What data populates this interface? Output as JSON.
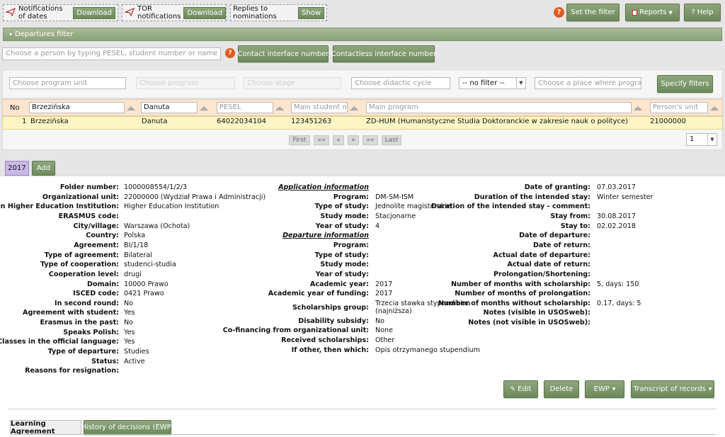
{
  "toolbar": {
    "notif_dates": {
      "label": "Notifications of dates",
      "button": "Download"
    },
    "notif_tor": {
      "label": "TOR notifications",
      "button": "Download"
    },
    "replies": {
      "label": "Replies to nominations",
      "button": "Show"
    },
    "help_mark": "?",
    "set_filter": "Set the filter",
    "reports": "Reports",
    "help": "Help"
  },
  "departures_filter": {
    "label": "Departures filter"
  },
  "person_search": {
    "placeholder": "Choose a person by typing PESEL, student number or name",
    "help_mark": "?",
    "contact_btn": "Contact interface number",
    "contactless_btn": "Contactless interface number"
  },
  "filters": {
    "program_unit": "Choose program unit",
    "program": "Choose program",
    "stage": "Choose stage",
    "didactic_cycle": "Choose didactic cycle",
    "no_filter": "-- no filter --",
    "place": "Choose a place where program is ta",
    "specify_btn": "Specify filters"
  },
  "table": {
    "headers": {
      "no": "No",
      "surname": "Brzezińska",
      "name": "Danuta",
      "pesel": "PESEL",
      "student_no": "Main student nur",
      "program": "Main program",
      "unit": "Person's unit"
    },
    "row": {
      "no": "1",
      "surname": "Brzezińska",
      "name": "Danuta",
      "pesel": "64022034104",
      "student_no": "123451263",
      "program": "ZD-HUM (Humanistyczne Studia Doktoranckie w zakresie nauk o polityce)",
      "unit": "21000000"
    },
    "pagination": {
      "first": "First",
      "prev2": "««",
      "prev": "«",
      "next": "»",
      "next2": "»»",
      "last": "Last",
      "page": "1"
    }
  },
  "tabs": {
    "year": "2017",
    "add": "Add"
  },
  "details": {
    "col1": [
      {
        "label": "Folder number:",
        "value": "1000008554/1/2/3"
      },
      {
        "label": "Organizational unit:",
        "value": "22000000 (Wydział Prawa i Administracji)"
      },
      {
        "label": "Foreign Higher Education Institution:",
        "value": "Higher Education Institution"
      },
      {
        "label": "ERASMUS code:",
        "value": ""
      },
      {
        "label": "City/village:",
        "value": "Warszawa (Ochota)"
      },
      {
        "label": "Country:",
        "value": "Polska"
      },
      {
        "label": "Agreement:",
        "value": "BI/1/18"
      },
      {
        "label": "Type of agreement:",
        "value": "Bilateral"
      },
      {
        "label": "Type of cooperation:",
        "value": "studenci-studia"
      },
      {
        "label": "Cooperation level:",
        "value": "drugi"
      },
      {
        "label": "Domain:",
        "value": "10000 Prawo"
      },
      {
        "label": "ISCED code:",
        "value": "0421 Prawo"
      },
      {
        "label": "In second round:",
        "value": "No"
      },
      {
        "label": "Agreement with student:",
        "value": "Yes"
      },
      {
        "label": "Erasmus in the past:",
        "value": "No"
      },
      {
        "label": "Speaks Polish:",
        "value": "Yes"
      },
      {
        "label": "Classes in the official language:",
        "value": "Yes"
      },
      {
        "label": "Type of departure:",
        "value": "Studies"
      },
      {
        "label": "Status:",
        "value": "Active"
      },
      {
        "label": "Reasons for resignation:",
        "value": ""
      }
    ],
    "application_info": "Application information",
    "departure_info": "Departure information",
    "col2a": [
      {
        "label": "Program:",
        "value": "DM-SM-ISM"
      },
      {
        "label": "Type of study:",
        "value": "Jednolite magisterskie"
      },
      {
        "label": "Study mode:",
        "value": "Stacjonarne"
      },
      {
        "label": "Year of study:",
        "value": "4"
      }
    ],
    "col2b": [
      {
        "label": "Program:",
        "value": ""
      },
      {
        "label": "Type of study:",
        "value": ""
      },
      {
        "label": "Study mode:",
        "value": ""
      },
      {
        "label": "Year of study:",
        "value": ""
      },
      {
        "label": "Academic year:",
        "value": "2017"
      },
      {
        "label": "Academic year of funding:",
        "value": "2017"
      }
    ],
    "scholarships_group": {
      "label": "Scholarships group:",
      "line1": "Trzecia stawka stypendialna",
      "line2": "(najniższa)"
    },
    "col2c": [
      {
        "label": "Disability subsidy:",
        "value": "No"
      },
      {
        "label": "Co-financing from organizational unit:",
        "value": "None"
      },
      {
        "label": "Received scholarships:",
        "value": "Other"
      },
      {
        "label": "If other, then which:",
        "value": "Opis otrzymanego stupendium"
      }
    ],
    "col3": [
      {
        "label": "Date of granting:",
        "value": "07.03.2017"
      },
      {
        "label": "Duration of the intended stay:",
        "value": "Winter semester"
      },
      {
        "label": "Duration of the intended stay - comment:",
        "value": ""
      },
      {
        "label": "Stay from:",
        "value": "30.08.2017"
      },
      {
        "label": "Stay to:",
        "value": "02.02.2018"
      },
      {
        "label": "Date of departure:",
        "value": ""
      },
      {
        "label": "Date of return:",
        "value": ""
      },
      {
        "label": "Actual date of departure:",
        "value": ""
      },
      {
        "label": "Actual date of return:",
        "value": ""
      },
      {
        "label": "Prolongation/Shortening:",
        "value": ""
      },
      {
        "label": "Number of months with scholarship:",
        "value": "5, days: 150"
      },
      {
        "label": "Number of months of prolongation:",
        "value": ""
      },
      {
        "label": "Number of months without scholarship:",
        "value": "0.17, days: 5"
      },
      {
        "label": "Notes (visible in USOSweb):",
        "value": ""
      },
      {
        "label": "Notes (not visible in USOSweb):",
        "value": ""
      }
    ]
  },
  "actions": {
    "edit": "Edit",
    "delete": "Delete",
    "ewp": "EWP",
    "transcript": "Transcript of records"
  },
  "bottom_tabs": {
    "learning": "Learning Agreement",
    "history": "History of decisions (EWP)"
  }
}
